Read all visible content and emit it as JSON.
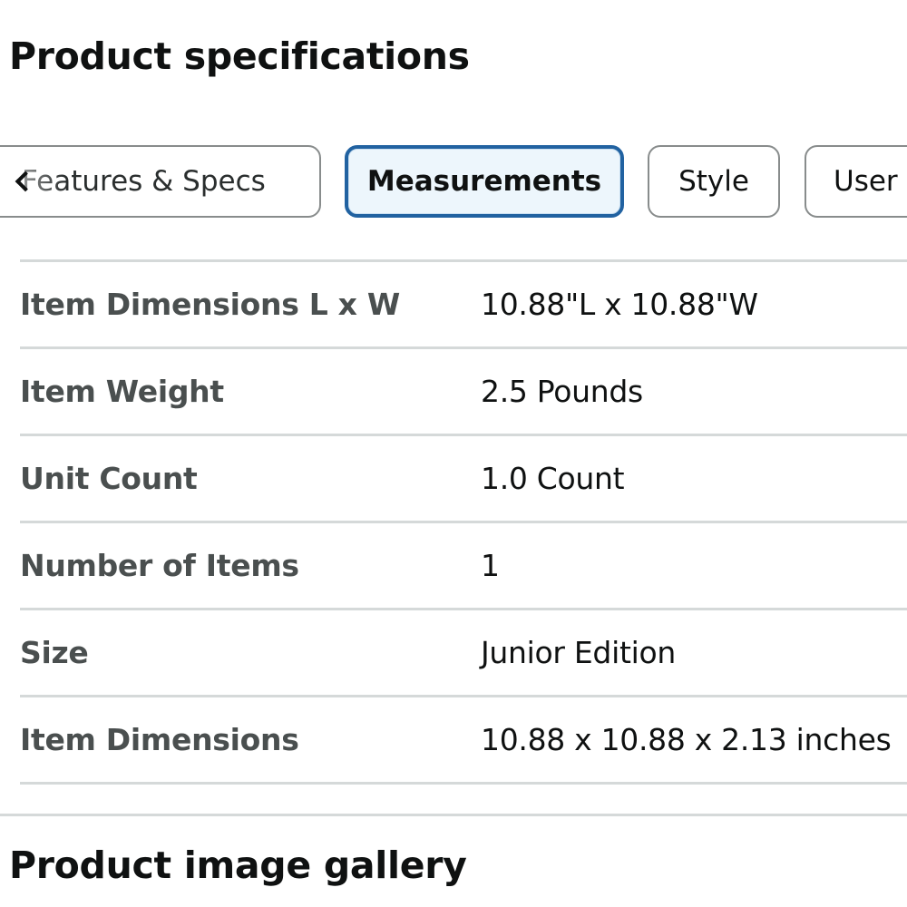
{
  "spec_section": {
    "title": "Product specifications"
  },
  "tabs": [
    {
      "label": "Features & Specs",
      "selected": false
    },
    {
      "label": "Measurements",
      "selected": true
    },
    {
      "label": "Style",
      "selected": false
    },
    {
      "label": "User",
      "selected": false
    }
  ],
  "specs": [
    {
      "label": "Item Dimensions L x W",
      "value": "10.88\"L x 10.88\"W"
    },
    {
      "label": "Item Weight",
      "value": "2.5 Pounds"
    },
    {
      "label": "Unit Count",
      "value": "1.0 Count"
    },
    {
      "label": "Number of Items",
      "value": "1"
    },
    {
      "label": "Size",
      "value": "Junior Edition"
    },
    {
      "label": "Item Dimensions",
      "value": "10.88 x 10.88 x 2.13 inches"
    }
  ],
  "gallery_section": {
    "title": "Product image gallery"
  },
  "icons": {
    "scroll_left": "chevron-left-icon"
  },
  "colors": {
    "selected_tab_border": "#2162a1",
    "selected_tab_background": "#edf6fc",
    "tab_border": "#888c8c",
    "divider": "#d5d9d9",
    "label_text": "#4a4f4f",
    "value_text": "#0f1111"
  }
}
